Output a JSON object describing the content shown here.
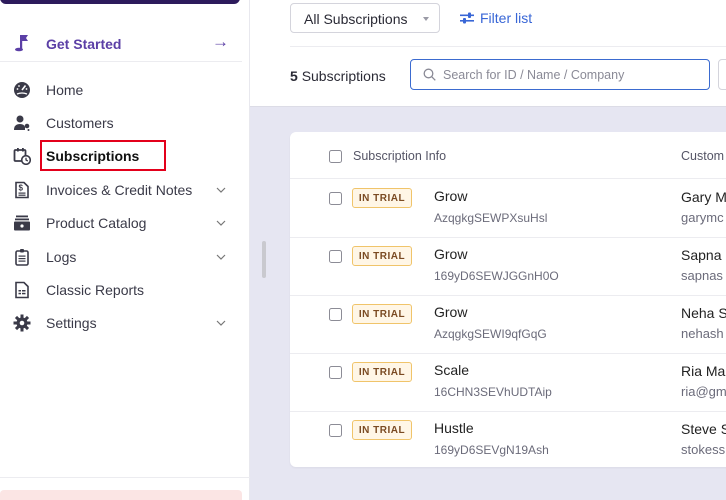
{
  "sidebar": {
    "get_started": {
      "label": "Get Started",
      "icon": "flag-icon",
      "arrow": "→"
    },
    "items": [
      {
        "label": "Home",
        "icon": "dashboard-gauge-icon",
        "has_chevron": false
      },
      {
        "label": "Customers",
        "icon": "customers-icon",
        "has_chevron": false
      },
      {
        "label": "Subscriptions",
        "icon": "calendar-clock-icon",
        "has_chevron": false,
        "active": true
      },
      {
        "label": "Invoices & Credit Notes",
        "icon": "invoice-icon",
        "has_chevron": true
      },
      {
        "label": "Product Catalog",
        "icon": "product-catalog-icon",
        "has_chevron": true
      },
      {
        "label": "Logs",
        "icon": "clipboard-icon",
        "has_chevron": true
      },
      {
        "label": "Classic Reports",
        "icon": "report-icon",
        "has_chevron": false
      },
      {
        "label": "Settings",
        "icon": "gear-icon",
        "has_chevron": true
      }
    ]
  },
  "header": {
    "view_select": {
      "selected": "All Subscriptions"
    },
    "filter_link": "Filter list",
    "count": {
      "number": "5",
      "label": "Subscriptions"
    },
    "search": {
      "placeholder": "Search for ID / Name / Company",
      "value": ""
    }
  },
  "table": {
    "columns": [
      "Subscription Info",
      "Custom"
    ],
    "rows": [
      {
        "status": "IN TRIAL",
        "plan": "Grow",
        "id": "AzqgkgSEWPXsuHsl",
        "customer_name": "Gary M",
        "customer_email": "garymc"
      },
      {
        "status": "IN TRIAL",
        "plan": "Grow",
        "id": "169yD6SEWJGGnH0O",
        "customer_name": "Sapna",
        "customer_email": "sapnas"
      },
      {
        "status": "IN TRIAL",
        "plan": "Grow",
        "id": "AzqgkgSEWI9qfGqG",
        "customer_name": "Neha S",
        "customer_email": "nehash"
      },
      {
        "status": "IN TRIAL",
        "plan": "Scale",
        "id": "16CHN3SEVhUDTAip",
        "customer_name": "Ria Ma",
        "customer_email": "ria@gm"
      },
      {
        "status": "IN TRIAL",
        "plan": "Hustle",
        "id": "169yD6SEVgN19Ash",
        "customer_name": "Steve S",
        "customer_email": "stokess"
      }
    ]
  },
  "colors": {
    "brand_purple": "#5b3fa6",
    "link_blue": "#3866d6",
    "highlight_red": "#e3001b",
    "trial_badge_border": "#f0c46a",
    "trial_badge_bg": "#fff6e6"
  }
}
